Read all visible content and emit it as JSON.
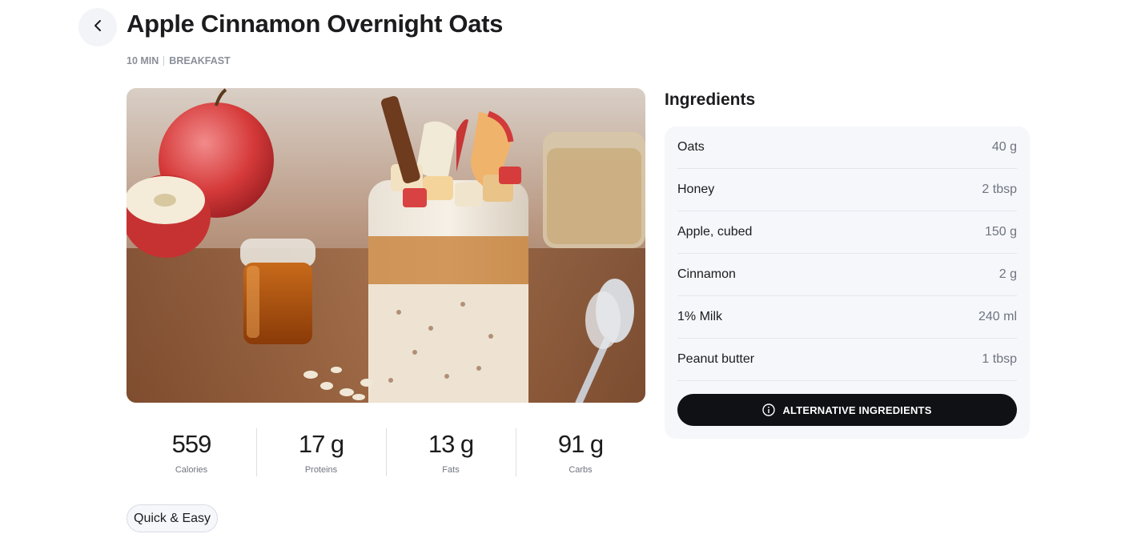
{
  "header": {
    "title": "Apple Cinnamon Overnight Oats",
    "time": "10 MIN",
    "category": "BREAKFAST"
  },
  "hero_image": {
    "alt": "Apple cinnamon overnight oats in a jar"
  },
  "nutrition": [
    {
      "value": "559",
      "label": "Calories"
    },
    {
      "value": "17 g",
      "label": "Proteins"
    },
    {
      "value": "13 g",
      "label": "Fats"
    },
    {
      "value": "91 g",
      "label": "Carbs"
    }
  ],
  "tags": [
    "Quick & Easy"
  ],
  "ingredients": {
    "title": "Ingredients",
    "items": [
      {
        "name": "Oats",
        "qty": "40 g"
      },
      {
        "name": "Honey",
        "qty": "2 tbsp"
      },
      {
        "name": "Apple, cubed",
        "qty": "150 g"
      },
      {
        "name": "Cinnamon",
        "qty": "2 g"
      },
      {
        "name": "1% Milk",
        "qty": "240 ml"
      },
      {
        "name": "Peanut butter",
        "qty": "1 tbsp"
      }
    ],
    "alternative_label": "ALTERNATIVE INGREDIENTS"
  },
  "icons": {
    "back": "chevron-left-icon",
    "info": "info-icon"
  },
  "colors": {
    "button_bg": "#0f1115",
    "card_bg": "#f6f7fb",
    "muted": "#8a8f99"
  }
}
